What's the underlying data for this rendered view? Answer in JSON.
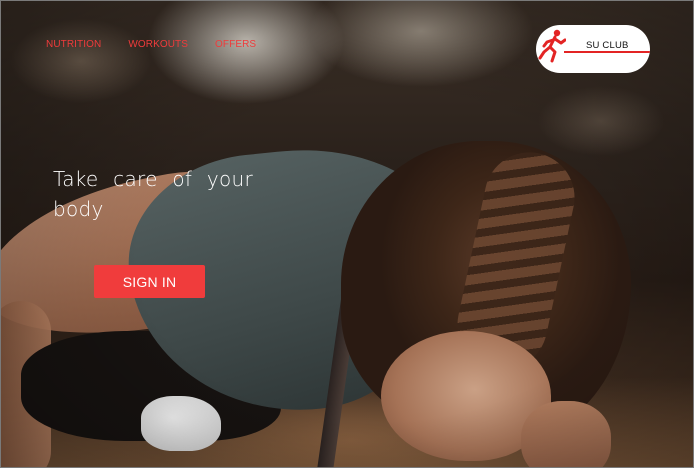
{
  "nav": {
    "items": [
      {
        "label": "NUTRITION"
      },
      {
        "label": "WORKOUTS"
      },
      {
        "label": "OFFERS"
      }
    ]
  },
  "logo": {
    "text": "SU CLUB",
    "icon": "runner-icon",
    "accent_color": "#e32424"
  },
  "hero": {
    "title": "Take care of your body",
    "sign_in_label": "SIGN IN"
  },
  "colors": {
    "nav_link": "#ef3b3b",
    "button_bg": "#f03c3c",
    "button_text": "#ffffff",
    "hero_text": "#ffffff"
  }
}
